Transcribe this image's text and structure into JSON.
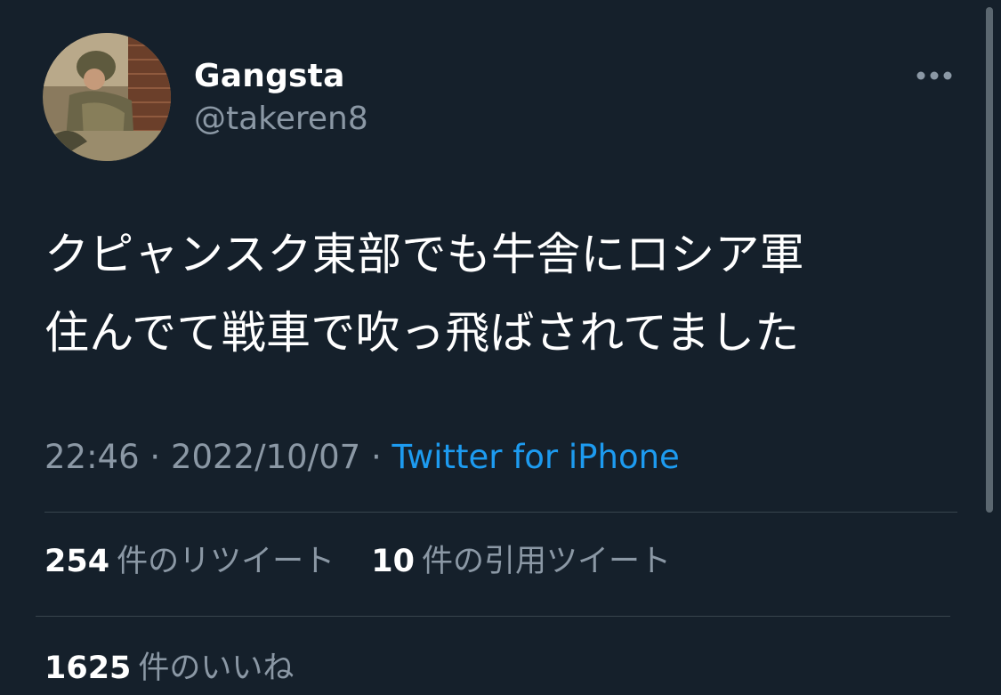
{
  "author": {
    "display_name": "Gangsta",
    "handle": "@takeren8"
  },
  "tweet": {
    "text": "クピャンスク東部でも牛舎にロシア軍\n住んでて戦車で吹っ飛ばされてました",
    "time": "22:46",
    "separator": " · ",
    "date": "2022/10/07",
    "source": "Twitter for iPhone"
  },
  "stats": {
    "retweets": {
      "count": "254",
      "label": "件のリツイート"
    },
    "quotes": {
      "count": "10",
      "label": "件の引用ツイート"
    },
    "likes": {
      "count": "1625",
      "label": "件のいいね"
    }
  },
  "icons": {
    "more": "more-horizontal-icon",
    "avatar": "avatar"
  },
  "colors": {
    "background": "#15202b",
    "text": "#ffffff",
    "secondary": "#8b98a5",
    "link": "#1d9bf0",
    "divider": "#38444d"
  }
}
